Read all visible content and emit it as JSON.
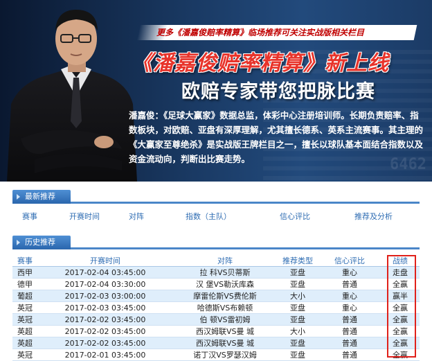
{
  "banner": {
    "top_strip": "更多《潘嘉俊赔率精算》临场推荐可关注实战版相关栏目",
    "title": "《潘嘉俊赔率精算》新上线",
    "subtitle": "欧赔专家带您把脉比赛",
    "description": "潘嘉俊：《足球大赢家》数据总监，体彩中心注册培训师。长期负责赔率、指数板块，对欧赔、亚盘有深厚理解，尤其擅长德系、英系主流赛事。其主理的《大赢家至尊绝杀》是实战版王牌栏目之一，擅长以球队基本面结合指数以及资金流动向，判断出比赛走势。",
    "bg_number": "6462"
  },
  "latest": {
    "tab": "最新推荐",
    "headers": [
      "赛事",
      "开赛时间",
      "对阵",
      "指数（主队）",
      "信心评比",
      "推荐及分析"
    ]
  },
  "history": {
    "tab": "历史推荐",
    "headers": [
      "赛事",
      "开赛时间",
      "对阵",
      "推荐类型",
      "信心评比",
      "战绩"
    ],
    "rows": [
      [
        "西甲",
        "2017-02-04 03:45:00",
        "拉 科VS贝蒂斯",
        "亚盘",
        "重心",
        "走盘"
      ],
      [
        "德甲",
        "2017-02-04 03:30:00",
        "汉 堡VS勒沃库森",
        "亚盘",
        "普通",
        "全赢"
      ],
      [
        "葡超",
        "2017-02-03 03:00:00",
        "摩雷伦斯VS费伦斯",
        "大小",
        "重心",
        "赢半"
      ],
      [
        "英冠",
        "2017-02-03 03:45:00",
        "哈德斯VS布赖顿",
        "亚盘",
        "重心",
        "全赢"
      ],
      [
        "英冠",
        "2017-02-02 03:45:00",
        "伯 顿VS雷初姆",
        "亚盘",
        "普通",
        "全赢"
      ],
      [
        "英超",
        "2017-02-02 03:45:00",
        "西汉姆联VS曼 城",
        "大小",
        "普通",
        "全赢"
      ],
      [
        "英超",
        "2017-02-02 03:45:00",
        "西汉姆联VS曼 城",
        "亚盘",
        "普通",
        "全赢"
      ],
      [
        "英冠",
        "2017-02-01 03:45:00",
        "诺丁汉VS罗瑟汉姆",
        "亚盘",
        "普通",
        "全赢"
      ]
    ]
  },
  "colors": {
    "accent_blue": "#2f6db3",
    "highlight_red": "#e0201a",
    "title_red": "#e8332a"
  }
}
